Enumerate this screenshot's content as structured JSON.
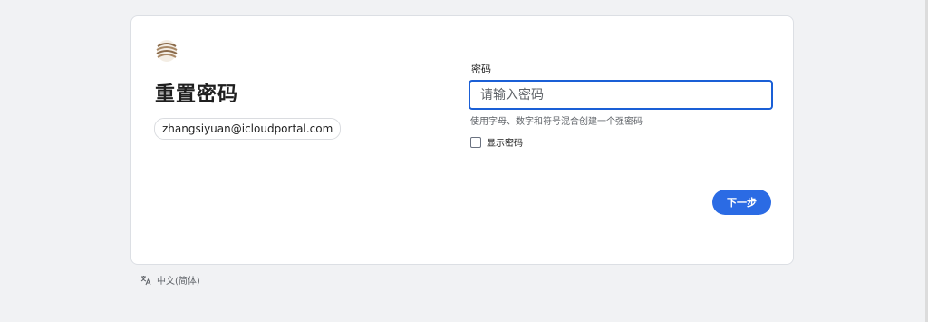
{
  "card": {
    "title": "重置密码",
    "email": "zhangsiyuan@icloudportal.com"
  },
  "form": {
    "password_label": "密码",
    "password_placeholder": "请输入密码",
    "password_value": "",
    "hint": "使用字母、数字和符号混合创建一个强密码",
    "show_password_label": "显示密码",
    "show_password_checked": false,
    "next_label": "下一步"
  },
  "footer": {
    "language": "中文(简体)"
  },
  "colors": {
    "accent": "#2b6be4",
    "focus_border": "#1a5fd6",
    "background": "#f1f2f4"
  },
  "icons": {
    "logo": "brand-logo",
    "language": "translate-icon"
  }
}
